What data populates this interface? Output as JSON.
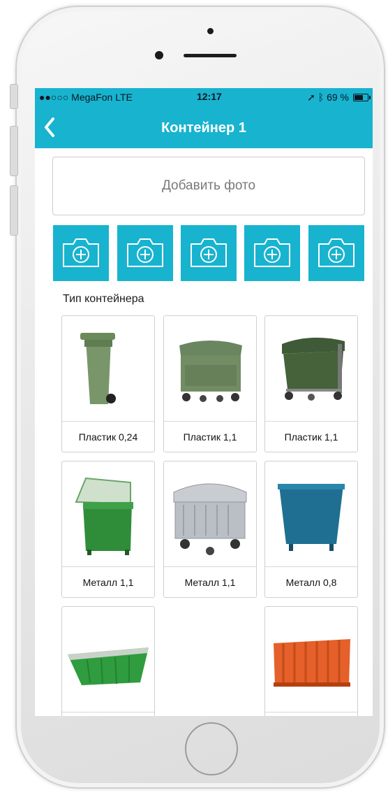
{
  "status_bar": {
    "carrier": "●●○○○ MegaFon  LTE",
    "time": "12:17",
    "battery_text": "69 %",
    "battery_level_pct": 69
  },
  "nav": {
    "title": "Контейнер 1",
    "back_icon": "chevron-left-icon"
  },
  "add_photo": {
    "label": "Добавить фото"
  },
  "photo_slots": {
    "count": 5,
    "icon": "camera-plus-icon"
  },
  "container_type": {
    "label": "Тип контейнера",
    "items": [
      {
        "caption": "Пластик 0,24",
        "kind": "plastic-bin-240"
      },
      {
        "caption": "Пластик 1,1",
        "kind": "plastic-bin-1100-flat"
      },
      {
        "caption": "Пластик 1,1",
        "kind": "plastic-bin-1100-round"
      },
      {
        "caption": "Металл 1,1",
        "kind": "metal-bin-green"
      },
      {
        "caption": "Металл 1,1",
        "kind": "metal-bin-galvanized"
      },
      {
        "caption": "Металл 0,8",
        "kind": "metal-bin-blue"
      },
      {
        "caption": "",
        "kind": "skip-container-green"
      },
      {
        "caption": "",
        "kind": "roll-off-container-orange"
      }
    ]
  },
  "colors": {
    "accent": "#18b3cf"
  }
}
